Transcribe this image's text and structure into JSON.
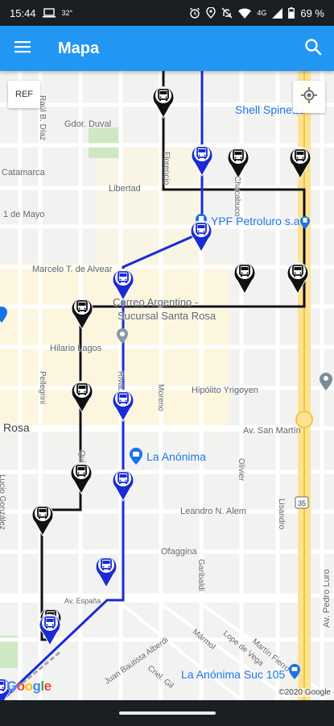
{
  "status_bar": {
    "time": "15:44",
    "temp": "32°",
    "network": "4G",
    "battery": "69 %",
    "icons": [
      "laptop-icon",
      "alarm-icon",
      "location-icon",
      "do-not-disturb-icon",
      "wifi-icon",
      "signal-icon",
      "battery-icon"
    ]
  },
  "app_bar": {
    "title": "Mapa",
    "color": "#2196f3"
  },
  "map": {
    "ref_button": "REF",
    "streets": {
      "gdor_duval": "Gdor. Duval",
      "catamarca": "Catamarca",
      "libertad": "Libertad",
      "uno_de_mayo": "1 de Mayo",
      "marcelo_alvear": "Marcelo T. de Alvear",
      "hilario_lagos": "Hilario Lagos",
      "hipolito_yrigoyen": "Hipólito Yrigoyen",
      "av_san_martin": "Av. San Martín",
      "leandro_alem": "Leandro N. Alem",
      "ofaggina": "Ofaggina",
      "av_espana": "Av. España",
      "juan_bautista_alberdi": "Juan Bautista Alberdi",
      "marmol": "Mármol",
      "lope_de_vega": "Lope de Vega",
      "martin_fierro": "Martín Fierro",
      "av_pedro_luro": "Av. Pedro Luro",
      "ruta": "35",
      "pellegrini": "Pellegrini",
      "rivadavia": "Rivadavia",
      "quintana": "Quintana",
      "moreno": "Moreno",
      "olivier": "Olivier",
      "lisandro": "Lisandro",
      "garibaldi": "Garibaldi",
      "raul_alfonsin": "Raúl B. Díaz",
      "cervantes": "Cnel. Gil",
      "florencio": "Florencio",
      "chacabuco": "Chacabuco",
      "lucio_gonzalez": "Lucio González"
    },
    "city_label": "Rosa",
    "pois": {
      "shell": "Shell Spinetto",
      "ypf": "YPF Petroluro s.a",
      "correo_line1": "Correo Argentino -",
      "correo_line2": "Sucursal Santa Rosa",
      "la_anonima": "La Anónima",
      "la_anonima_105": "La Anónima Suc 105"
    },
    "google_logo": [
      "G",
      "o",
      "o",
      "g",
      "l",
      "e"
    ],
    "copyright": "©2020 Google",
    "route_colors": {
      "black_route": "#111111",
      "blue_route": "#1a2bd6"
    },
    "bus_stop_icon": "bus-icon"
  }
}
